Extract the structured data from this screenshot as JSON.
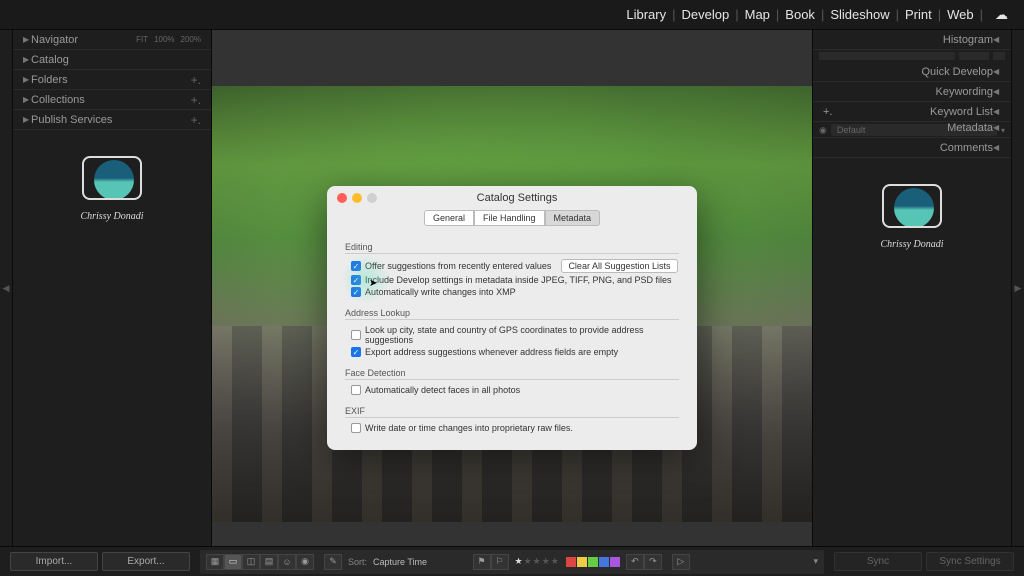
{
  "top_nav": {
    "items": [
      "Library",
      "Develop",
      "Map",
      "Book",
      "Slideshow",
      "Print",
      "Web"
    ]
  },
  "left_panel": {
    "navigator": {
      "label": "Navigator",
      "fit": "FIT",
      "z1": "100%",
      "z2": "200%"
    },
    "sections": [
      {
        "label": "Catalog",
        "plus": ""
      },
      {
        "label": "Folders",
        "plus": "+."
      },
      {
        "label": "Collections",
        "plus": "+."
      },
      {
        "label": "Publish Services",
        "plus": "+."
      }
    ],
    "logo_sig": "Chrissy Donadi"
  },
  "right_panel": {
    "sections": [
      {
        "label": "Histogram"
      },
      {
        "label": "Quick Develop"
      },
      {
        "label": "Keywording"
      },
      {
        "label": "Keyword List"
      },
      {
        "label": "Metadata",
        "prefix": "Default"
      },
      {
        "label": "Comments"
      }
    ]
  },
  "dialog": {
    "title": "Catalog Settings",
    "tabs": [
      "General",
      "File Handling",
      "Metadata"
    ],
    "active_tab": 2,
    "editing": {
      "title": "Editing",
      "opt1": "Offer suggestions from recently entered values",
      "clear": "Clear All Suggestion Lists",
      "opt2": "Include Develop settings in metadata inside JPEG, TIFF, PNG, and PSD files",
      "opt3": "Automatically write changes into XMP"
    },
    "address": {
      "title": "Address Lookup",
      "opt1": "Look up city, state and country of GPS coordinates to provide address suggestions",
      "opt2": "Export address suggestions whenever address fields are empty"
    },
    "faces": {
      "title": "Face Detection",
      "opt1": "Automatically detect faces in all photos"
    },
    "exif": {
      "title": "EXIF",
      "opt1": "Write date or time changes into proprietary raw files."
    }
  },
  "bottom": {
    "import": "Import...",
    "export": "Export...",
    "sort_label": "Sort:",
    "sort_value": "Capture Time",
    "sync": "Sync",
    "sync_settings": "Sync Settings",
    "swatches": [
      "#d44",
      "#e93",
      "#ec4",
      "#6c4",
      "#4ac",
      "#47d",
      "#a5d",
      "#999"
    ]
  }
}
